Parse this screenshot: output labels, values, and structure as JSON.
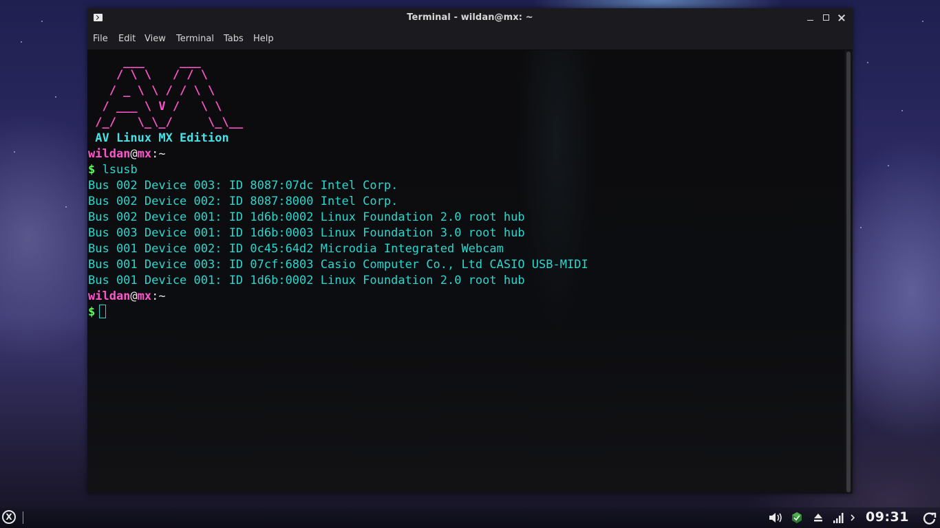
{
  "window": {
    "title": "Terminal - wildan@mx: ~",
    "menu": [
      "File",
      "Edit",
      "View",
      "Terminal",
      "Tabs",
      "Help"
    ]
  },
  "terminal": {
    "ascii_logo": [
      "     ___     ___",
      "    / \\ \\   / / \\",
      "   / _ \\ \\ / / \\ \\",
      "  / ___ \\ V /   \\ \\",
      " /_/   \\_\\_/     \\_\\__"
    ],
    "banner": " AV Linux MX Edition",
    "prompt_user": "wildan",
    "prompt_at": "@",
    "prompt_host": "mx",
    "prompt_path": ":~",
    "prompt_symbol": "$",
    "command": "lsusb",
    "output": [
      "Bus 002 Device 003: ID 8087:07dc Intel Corp.",
      "Bus 002 Device 002: ID 8087:8000 Intel Corp.",
      "Bus 002 Device 001: ID 1d6b:0002 Linux Foundation 2.0 root hub",
      "Bus 003 Device 001: ID 1d6b:0003 Linux Foundation 3.0 root hub",
      "Bus 001 Device 002: ID 0c45:64d2 Microdia Integrated Webcam",
      "Bus 001 Device 003: ID 07cf:6803 Casio Computer Co., Ltd CASIO USB-MIDI",
      "Bus 001 Device 001: ID 1d6b:0002 Linux Foundation 2.0 root hub"
    ]
  },
  "taskbar": {
    "start_icon": "x-logo-icon",
    "tray_icons": [
      "volume-icon",
      "package-updater-icon",
      "eject-icon",
      "network-signal-icon",
      "chevron-right-icon"
    ],
    "clock": "09:31",
    "power_icon": "power-icon"
  },
  "colors": {
    "prompt_user": "#ff55cc",
    "prompt_symbol": "#55ff55",
    "output_text": "#2ad7cf",
    "banner": "#49e0e6"
  }
}
